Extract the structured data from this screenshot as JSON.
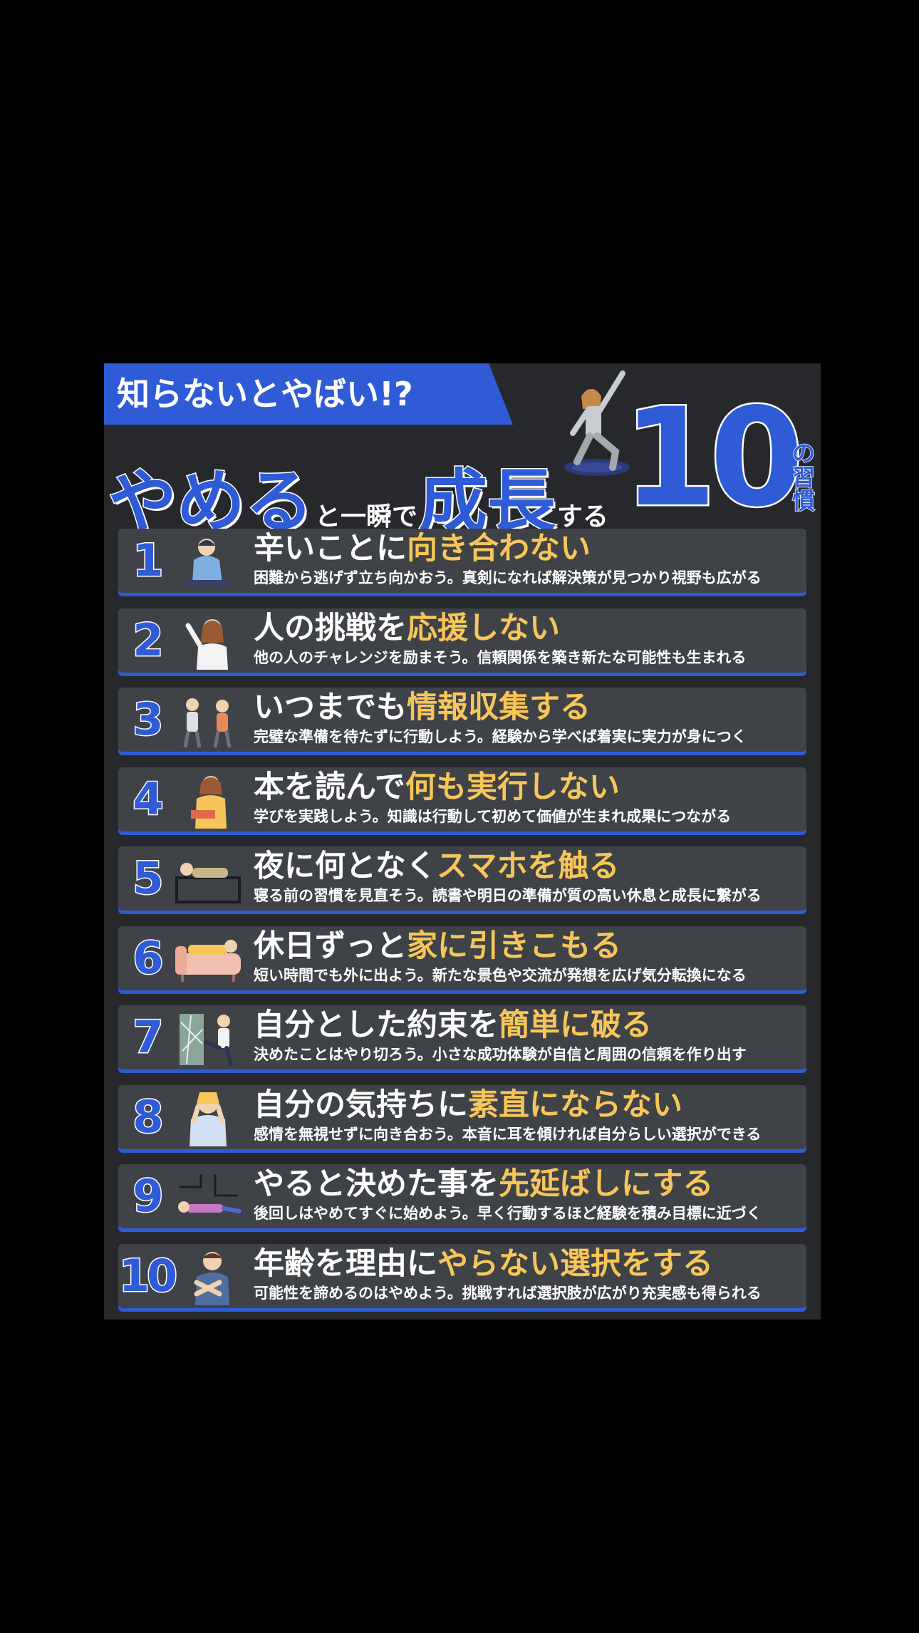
{
  "banner": {
    "text": "知らないとやばい!?"
  },
  "headline": {
    "part1": "やめる",
    "part2": "と一瞬で",
    "part3": "成長",
    "part4": "する",
    "number": "10",
    "suffix": [
      "の",
      "習",
      "慣"
    ]
  },
  "colors": {
    "accent_blue": "#2f5bd6",
    "gold": "#f7c65a",
    "card": "#3f4246",
    "poster_bg": "#26282c"
  },
  "items": [
    {
      "number": "1",
      "title_white": "辛いことに",
      "title_gold": "向き合わない",
      "desc": "困難から逃げず立ち向かおう。真剣になれば解決策が見つかり視野も広がる",
      "icon": "distressed-person-icon"
    },
    {
      "number": "2",
      "title_white": "人の挑戦を",
      "title_gold": "応援しない",
      "desc": "他の人のチャレンジを励まそう。信頼関係を築き新たな可能性も生まれる",
      "icon": "worried-woman-icon"
    },
    {
      "number": "3",
      "title_white": "いつまでも",
      "title_gold": "情報収集する",
      "desc": "完璧な準備を待たずに行動しよう。経験から学べば着実に実力が身につく",
      "icon": "binoculars-people-icon"
    },
    {
      "number": "4",
      "title_white": "本を読んで",
      "title_gold": "何も実行しない",
      "desc": "学びを実践しよう。知識は行動して初めて価値が生まれ成果につながる",
      "icon": "reading-woman-icon"
    },
    {
      "number": "5",
      "title_white": "夜に何となく",
      "title_gold": "スマホを触る",
      "desc": "寝る前の習慣を見直そう。読書や明日の準備が質の高い休息と成長に繋がる",
      "icon": "phone-on-sofa-icon"
    },
    {
      "number": "6",
      "title_white": "休日ずっと",
      "title_gold": "家に引きこもる",
      "desc": "短い時間でも外に出よう。新たな景色や交流が発想を広げ気分転換になる",
      "icon": "lying-on-couch-icon"
    },
    {
      "number": "7",
      "title_white": "自分とした約束を",
      "title_gold": "簡単に破る",
      "desc": "決めたことはやり切ろう。小さな成功体験が自信と周囲の信頼を作り出す",
      "icon": "breaking-glass-icon"
    },
    {
      "number": "8",
      "title_white": "自分の気持ちに",
      "title_gold": "素直にならない",
      "desc": "感情を無視せずに向き合おう。本音に耳を傾ければ自分らしい選択ができる",
      "icon": "hands-on-face-icon"
    },
    {
      "number": "9",
      "title_white": "やると決めた事を",
      "title_gold": "先延ばしにする",
      "desc": "後回しはやめてすぐに始めよう。早く行動するほど経験を積み目標に近づく",
      "icon": "lying-on-floor-icon"
    },
    {
      "number": "10",
      "title_white": "年齢を理由に",
      "title_gold": "やらない選択をする",
      "desc": "可能性を諦めるのはやめよう。挑戦すれば選択肢が広がり充実感も得られる",
      "icon": "refusing-man-icon"
    }
  ]
}
